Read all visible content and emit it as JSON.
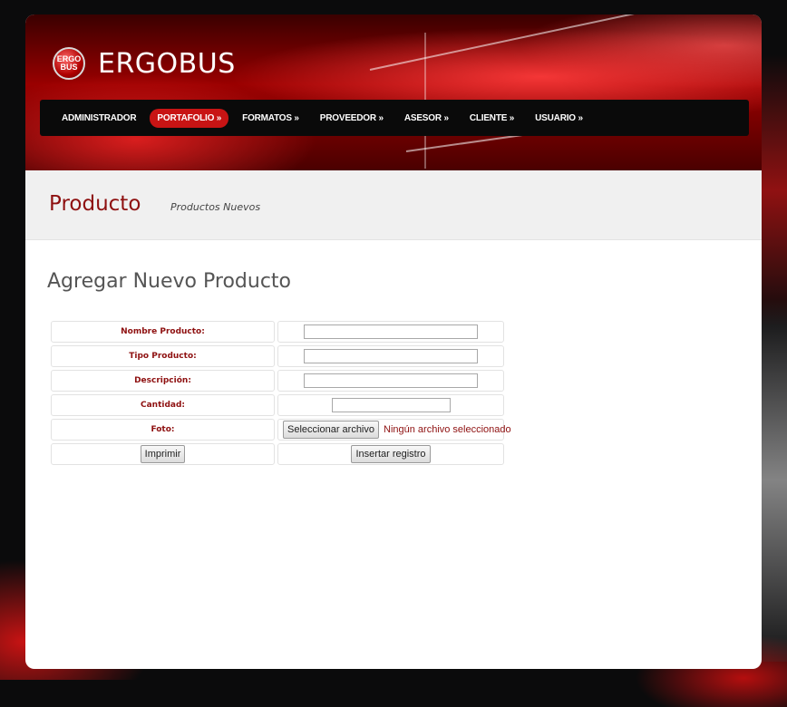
{
  "brand": {
    "badge_top": "ERGO",
    "badge_bottom": "BUS",
    "name": "ERGOBUS"
  },
  "nav": {
    "items": [
      {
        "label": "ADMINISTRADOR",
        "active": false
      },
      {
        "label": "PORTAFOLIO »",
        "active": true
      },
      {
        "label": "FORMATOS »",
        "active": false
      },
      {
        "label": "PROVEEDOR »",
        "active": false
      },
      {
        "label": "ASESOR »",
        "active": false
      },
      {
        "label": "CLIENTE »",
        "active": false
      },
      {
        "label": "USUARIO »",
        "active": false
      }
    ]
  },
  "page": {
    "title": "Producto",
    "subtitle": "Productos Nuevos",
    "section_title": "Agregar Nuevo Producto"
  },
  "form": {
    "fields": [
      {
        "label": "Nombre Producto:",
        "value": ""
      },
      {
        "label": "Tipo Producto:",
        "value": ""
      },
      {
        "label": "Descripción:",
        "value": ""
      },
      {
        "label": "Cantidad:",
        "value": ""
      },
      {
        "label": "Foto:",
        "button": "Seleccionar archivo",
        "status": "Ningún archivo seleccionado"
      }
    ],
    "print_button": "Imprimir",
    "submit_button": "Insertar registro"
  },
  "colors": {
    "accent": "#8e1010",
    "nav_active": "#c81414",
    "nav_bg": "#0a0a0a"
  }
}
